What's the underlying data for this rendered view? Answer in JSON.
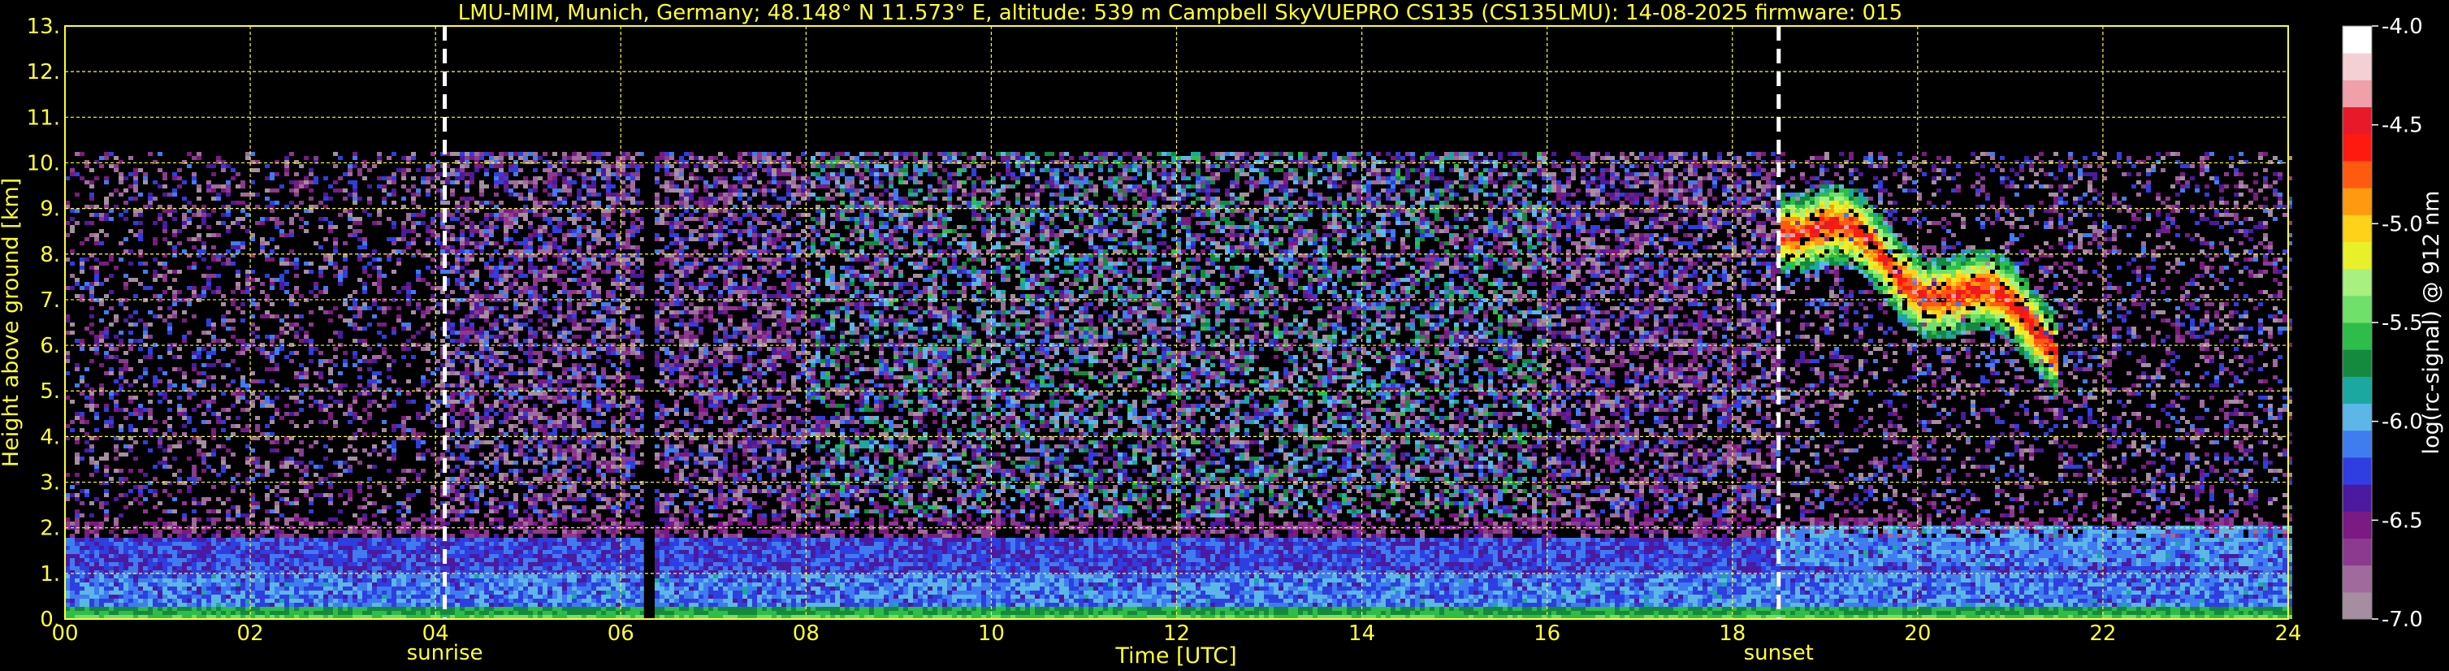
{
  "chart_data": {
    "type": "heatmap",
    "title": "LMU-MIM, Munich, Germany; 48.148° N 11.573° E, altitude: 539 m    Campbell SkyVUEPRO CS135 (CS135LMU): 14-08-2025    firmware: 015",
    "xlabel": "Time [UTC]",
    "ylabel": "Height above ground [km]",
    "xlim": [
      0,
      24
    ],
    "ylim": [
      0,
      13
    ],
    "x_ticks": [
      "00",
      "02",
      "04",
      "06",
      "08",
      "10",
      "12",
      "14",
      "16",
      "18",
      "20",
      "22",
      "24"
    ],
    "y_ticks": [
      "0.",
      "1.",
      "2.",
      "3.",
      "4.",
      "5.",
      "6.",
      "7.",
      "8.",
      "9.",
      "10.",
      "11.",
      "12.",
      "13."
    ],
    "grid": true,
    "markers": [
      {
        "label": "sunrise",
        "x": 4.1
      },
      {
        "label": "sunset",
        "x": 18.5
      }
    ],
    "colorbar": {
      "label": "log(rc-signal) @ 912 nm",
      "ticks": [
        "-4.0",
        "-4.5",
        "-5.0",
        "-5.5",
        "-6.0",
        "-6.5",
        "-7.0"
      ],
      "range": [
        -7.0,
        -4.0
      ],
      "colors": [
        "#a58ea0",
        "#a06b9c",
        "#8b3a8f",
        "#7a1a82",
        "#4b1aa0",
        "#2f3ee0",
        "#3f7cf0",
        "#5cb7e8",
        "#1ba8a0",
        "#148a3f",
        "#2fbd4a",
        "#6fe06a",
        "#a8f080",
        "#e8f02a",
        "#ffd21a",
        "#ff9a10",
        "#ff5a10",
        "#ff1a10",
        "#e81a2a",
        "#f0a0a8",
        "#f3d0d4",
        "#ffffff"
      ]
    },
    "layers": [
      {
        "name": "noise background",
        "x": [
          0,
          24
        ],
        "y": [
          2.0,
          10.3
        ],
        "level": -6.6
      },
      {
        "name": "aerosol boundary layer",
        "x": [
          0,
          24
        ],
        "y": [
          0.0,
          2.3
        ],
        "level": -6.0
      },
      {
        "name": "cirrus cloud",
        "x": [
          18.5,
          21.5
        ],
        "y": [
          6.8,
          9.5
        ],
        "level": -4.8
      }
    ],
    "gaps": [
      {
        "x": [
          6.25,
          6.35
        ],
        "y": [
          0,
          10.3
        ]
      }
    ]
  }
}
